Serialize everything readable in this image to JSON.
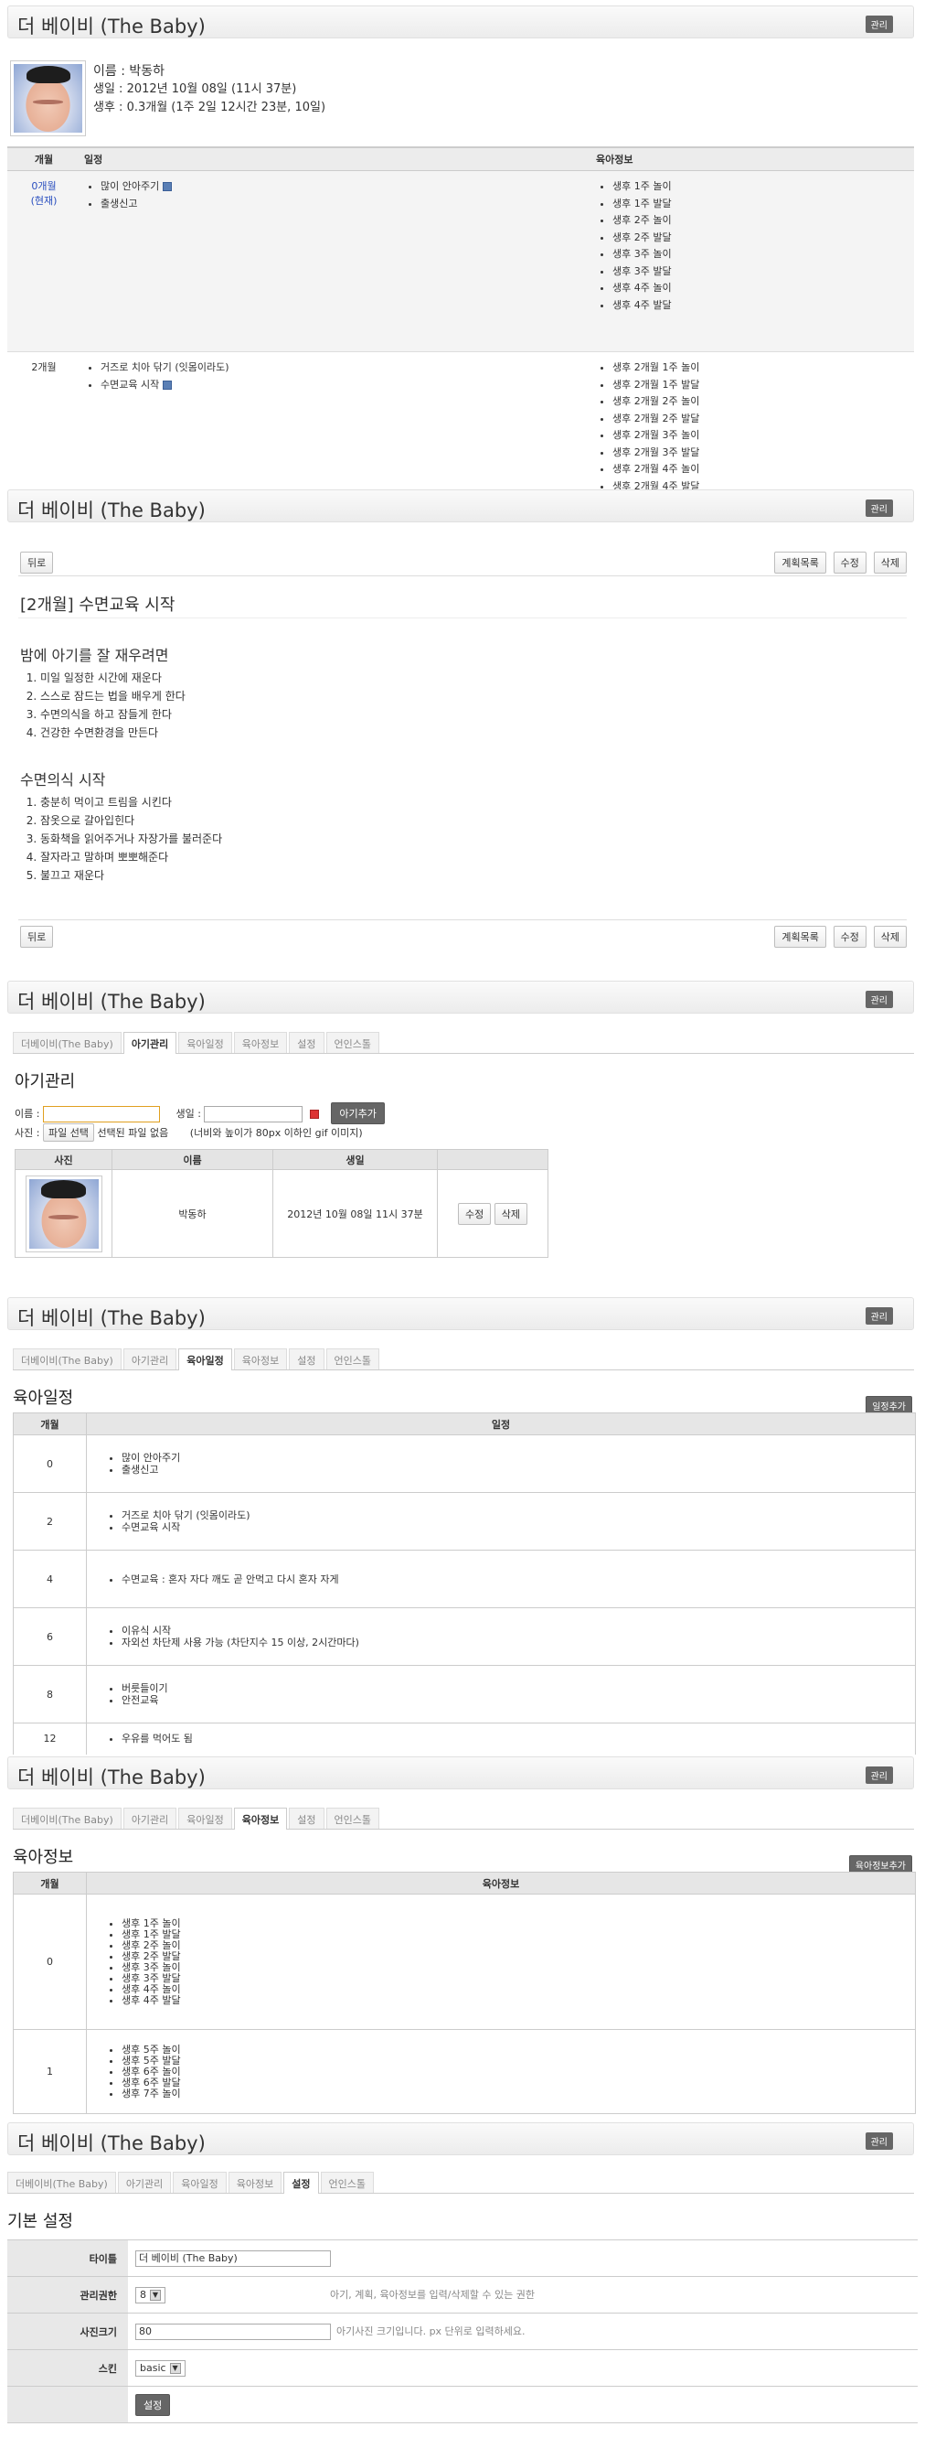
{
  "app_title": "더 베이비 (The Baby)",
  "admin_label": "관리",
  "baby": {
    "name_line": "이름 : 박동하",
    "birth_line": "생일 : 2012년 10월 08일 (11시 37분)",
    "age_line": "생후 : 0.3개월 (1주 2일 12시간 23분, 10일)"
  },
  "timeline": {
    "headers": [
      "개월",
      "일정",
      "육아정보"
    ],
    "rows": [
      {
        "month": "0개월",
        "current": "(현재)",
        "schedule": [
          "많이 안아주기",
          "출생신고"
        ],
        "info": [
          "생후 1주 놀이",
          "생후 1주 발달",
          "생후 2주 놀이",
          "생후 2주 발달",
          "생후 3주 놀이",
          "생후 3주 발달",
          "생후 4주 놀이",
          "생후 4주 발달"
        ]
      },
      {
        "month": "2개월",
        "schedule": [
          "거즈로 치아 닦기 (잇몸이라도)",
          "수면교육 시작"
        ],
        "info": [
          "생후 2개월 1주 놀이",
          "생후 2개월 1주 발달",
          "생후 2개월 2주 놀이",
          "생후 2개월 2주 발달",
          "생후 2개월 3주 놀이",
          "생후 2개월 3주 발달",
          "생후 2개월 4주 놀이",
          "생후 2개월 4주 발달"
        ]
      }
    ]
  },
  "post": {
    "back": "뒤로",
    "list": "계획목록",
    "edit": "수정",
    "delete": "삭제",
    "title": "[2개월] 수면교육 시작",
    "section1": "밤에 아기를 잘 재우려면",
    "steps1": [
      "미일 일정한 시간에 재운다",
      "스스로 잠드는 법을 배우게 한다",
      "수면의식을 하고 잠들게 한다",
      "건강한 수면환경을 만든다"
    ],
    "section2": "수면의식 시작",
    "steps2": [
      "충분히 먹이고 트림을 시킨다",
      "잠옷으로 갈아입힌다",
      "동화책을 읽어주거나 자장가를 불러준다",
      "잘자라고 말하며 뽀뽀해준다",
      "불끄고 재운다"
    ]
  },
  "tabs": [
    "더베이비(The Baby)",
    "아기관리",
    "육아일정",
    "육아정보",
    "설정",
    "언인스톨"
  ],
  "baby_admin": {
    "heading": "아기관리",
    "name_label": "이름 :",
    "birth_label": "생일 :",
    "add_button": "아기추가",
    "photo_label": "사진 :",
    "file_button": "파일 선택",
    "file_status": "선택된 파일 없음",
    "photo_hint": "(너비와 높이가 80px 이하인 gif 이미지)",
    "headers": [
      "사진",
      "이름",
      "생일",
      ""
    ],
    "row": {
      "name": "박동하",
      "birth": "2012년 10월 08일 11시 37분",
      "edit": "수정",
      "delete": "삭제"
    }
  },
  "schedule_page": {
    "heading": "육아일정",
    "add_button": "일정추가",
    "headers": [
      "개월",
      "일정"
    ],
    "rows": [
      {
        "month": "0",
        "items": [
          "많이 안아주기",
          "출생신고"
        ]
      },
      {
        "month": "2",
        "items": [
          "거즈로 치아 닦기 (잇몸이라도)",
          "수면교육 시작"
        ]
      },
      {
        "month": "4",
        "items": [
          "수면교육 : 혼자 자다 깨도 곧 안먹고 다시 혼자 자게"
        ]
      },
      {
        "month": "6",
        "items": [
          "이유식 시작",
          "자외선 차단제 사용 가능 (차단지수 15 이상, 2시간마다)"
        ]
      },
      {
        "month": "8",
        "items": [
          "버릇들이기",
          "안전교육"
        ]
      },
      {
        "month": "12",
        "items": [
          "우유를 먹어도 됨"
        ]
      }
    ]
  },
  "info_page": {
    "heading": "육아정보",
    "add_button": "육아정보추가",
    "headers": [
      "개월",
      "육아정보"
    ],
    "rows": [
      {
        "month": "0",
        "items": [
          "생후 1주 놀이",
          "생후 1주 발달",
          "생후 2주 놀이",
          "생후 2주 발달",
          "생후 3주 놀이",
          "생후 3주 발달",
          "생후 4주 놀이",
          "생후 4주 발달"
        ]
      },
      {
        "month": "1",
        "items": [
          "생후 5주 놀이",
          "생후 5주 발달",
          "생후 6주 놀이",
          "생후 6주 발달",
          "생후 7주 놀이"
        ]
      }
    ]
  },
  "settings_page": {
    "heading": "기본 설정",
    "title_label": "타이틀",
    "title_value": "더 베이비 (The Baby)",
    "perm_label": "관리권한",
    "perm_value": "8",
    "perm_hint": "아기, 계획, 육아정보를 입력/삭제할 수 있는 권한",
    "size_label": "사진크기",
    "size_value": "80",
    "size_hint": "아기사진 크기입니다. px 단위로 입력하세요.",
    "skin_label": "스킨",
    "skin_value": "basic",
    "save_button": "설정"
  },
  "colors": {
    "current_month": "#2a4fbf",
    "button_dark": "#666666",
    "header_bg": "#ececec"
  }
}
